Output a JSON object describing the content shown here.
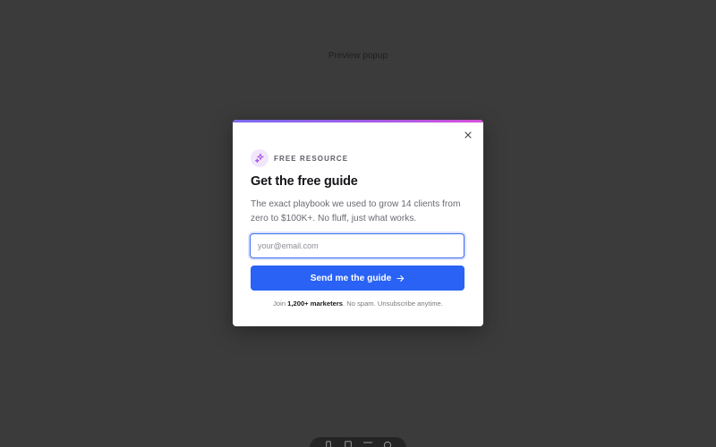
{
  "page": {
    "preview_label": "Preview popup"
  },
  "popup": {
    "eyebrow_icon": "sparkles-icon",
    "eyebrow_label": "FREE RESOURCE",
    "title": "Get the free guide",
    "description": "The exact playbook we used to grow 14 clients from zero to $100K+. No fluff, just what works.",
    "email_placeholder": "your@email.com",
    "email_value": "",
    "submit_label": "Send me the guide",
    "submit_icon": "arrow-right-icon",
    "close_icon": "close-icon",
    "footnote_prefix": "Join ",
    "footnote_bold": "1,200+ marketers",
    "footnote_suffix": ". No spam. Unsubscribe anytime."
  },
  "dock": {
    "items": [
      "mobile-icon",
      "tablet-icon",
      "desktop-icon",
      "settings-icon"
    ]
  },
  "colors": {
    "accent": "#2962f5",
    "gradient_start": "#7a6cf0",
    "gradient_end": "#d64fd8",
    "backdrop": "#3b3b3b"
  }
}
